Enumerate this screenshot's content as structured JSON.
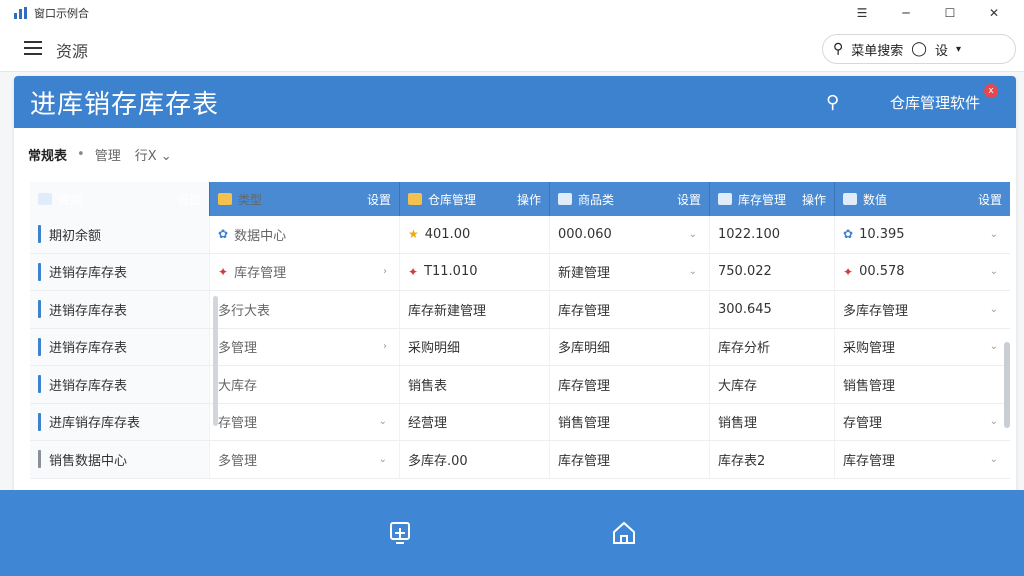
{
  "window": {
    "title": "窗口示例合"
  },
  "toolbar": {
    "nav_title": "资源",
    "search_label": "菜单搜索",
    "lang_label": "设"
  },
  "card": {
    "title": "进库销存库存表",
    "right_label": "仓库管理软件",
    "badge": "x"
  },
  "filter": {
    "main": "常规表",
    "sub": "管理",
    "select": "行X"
  },
  "columns": [
    {
      "label": "费用",
      "action": "设置"
    },
    {
      "label": "类型",
      "action": "设置"
    },
    {
      "label": "仓库管理",
      "action": "操作"
    },
    {
      "label": "商品类",
      "action": "设置"
    },
    {
      "label": "库存管理",
      "action": "操作"
    },
    {
      "label": "数值",
      "action": "设置"
    }
  ],
  "rows": [
    [
      "期初余额",
      "数据中心",
      "401.00",
      "000.060",
      "1022.100",
      "10.395"
    ],
    [
      "进销存库存表",
      "库存管理",
      "T11.010",
      "新建管理",
      "750.022",
      "00.578"
    ],
    [
      "进销存库存表",
      "多行大表",
      "库存新建管理",
      "库存管理",
      "300.645",
      "多库存管理"
    ],
    [
      "进销存库存表",
      "多管理",
      "采购明细",
      "多库明细",
      "库存分析",
      "采购管理"
    ],
    [
      "进销存库存表",
      "大库存",
      "销售表",
      "库存管理",
      "大库存",
      "销售管理"
    ],
    [
      "进库销存库存表",
      "存管理",
      "经营理",
      "销售管理",
      "销售理",
      "存管理"
    ],
    [
      "销售数据中心",
      "多管理",
      "多库存.00",
      "库存管理",
      "库存表2",
      "库存管理"
    ]
  ],
  "colors": {
    "primary": "#3c82cf",
    "header": "#4a8ad3",
    "bottom": "#3f86d4"
  }
}
